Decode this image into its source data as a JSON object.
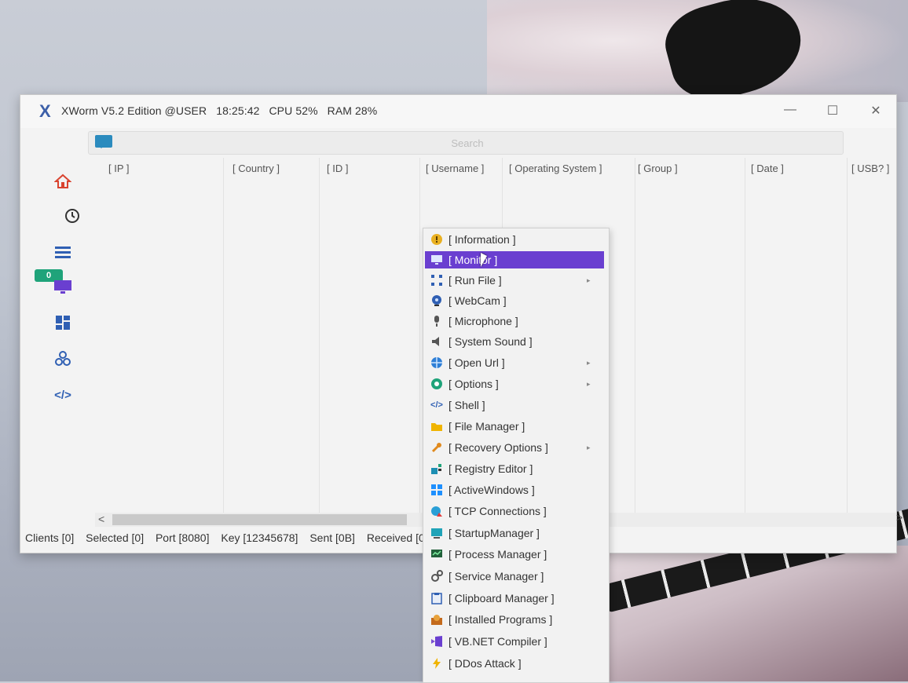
{
  "window": {
    "logo": "X",
    "title": "XWorm V5.2 Edition @USER",
    "time": "18:25:42",
    "cpu": "CPU 52%",
    "ram": "RAM 28%",
    "minimize": "—",
    "maximize": "☐",
    "close": "✕"
  },
  "search": {
    "placeholder": "Search"
  },
  "sidebar": {
    "badge": "0",
    "icons": [
      "home-icon",
      "history-icon",
      "list-icon",
      "monitor-icon",
      "dashboard-icon",
      "network-icon",
      "code-icon"
    ]
  },
  "columns": [
    "[ IP ]",
    "[ Country ]",
    "[ ID ]",
    "[ Username ]",
    "[ Operating System ]",
    "[ Group ]",
    "[ Date ]",
    "[ USB? ]"
  ],
  "scrollbar": {
    "left": "<",
    "right": ">"
  },
  "status": {
    "clients": "Clients [0]",
    "selected": "Selected [0]",
    "port": "Port [8080]",
    "key": "Key [12345678]",
    "sent": "Sent [0B]",
    "received": "Received [0B]"
  },
  "menu": {
    "items": [
      {
        "label": "[ Information ]",
        "icon": "info-icon",
        "submenu": false
      },
      {
        "label": "[ Monitor ]",
        "icon": "monitor-icon",
        "submenu": false,
        "active": true
      },
      {
        "label": "[ Run File ]",
        "icon": "run-file-icon",
        "submenu": true
      },
      {
        "label": "[ WebCam ]",
        "icon": "webcam-icon",
        "submenu": false
      },
      {
        "label": "[ Microphone ]",
        "icon": "microphone-icon",
        "submenu": false
      },
      {
        "label": "[ System Sound ]",
        "icon": "speaker-icon",
        "submenu": false
      },
      {
        "label": "[ Open Url ]",
        "icon": "globe-icon",
        "submenu": true
      },
      {
        "label": "[ Options ]",
        "icon": "options-icon",
        "submenu": true
      },
      {
        "label": "[ Shell ]",
        "icon": "shell-icon",
        "submenu": false
      },
      {
        "label": "[ File Manager ]",
        "icon": "folder-icon",
        "submenu": false
      },
      {
        "label": "[ Recovery Options ]",
        "icon": "wrench-icon",
        "submenu": true
      },
      {
        "label": "[ Registry Editor ]",
        "icon": "registry-icon",
        "submenu": false
      },
      {
        "label": "[ ActiveWindows ]",
        "icon": "windows-icon",
        "submenu": false
      },
      {
        "label": "[ TCP Connections ]",
        "icon": "tcp-icon",
        "submenu": false
      },
      {
        "label": "[ StartupManager ]",
        "icon": "startup-icon",
        "submenu": false
      },
      {
        "label": "[ Process Manager ]",
        "icon": "process-icon",
        "submenu": false
      },
      {
        "label": "[ Service Manager ]",
        "icon": "service-icon",
        "submenu": false
      },
      {
        "label": "[ Clipboard Manager ]",
        "icon": "clipboard-icon",
        "submenu": false
      },
      {
        "label": "[ Installed Programs ]",
        "icon": "installer-icon",
        "submenu": false
      },
      {
        "label": "[ VB.NET Compiler ]",
        "icon": "compiler-icon",
        "submenu": false
      },
      {
        "label": "[ DDos Attack ]",
        "icon": "lightning-icon",
        "submenu": false
      }
    ],
    "submenu_arrow": "▸"
  },
  "colors": {
    "accent": "#6a3fd0",
    "brand": "#3c5fa8",
    "badge": "#1fa37a"
  }
}
